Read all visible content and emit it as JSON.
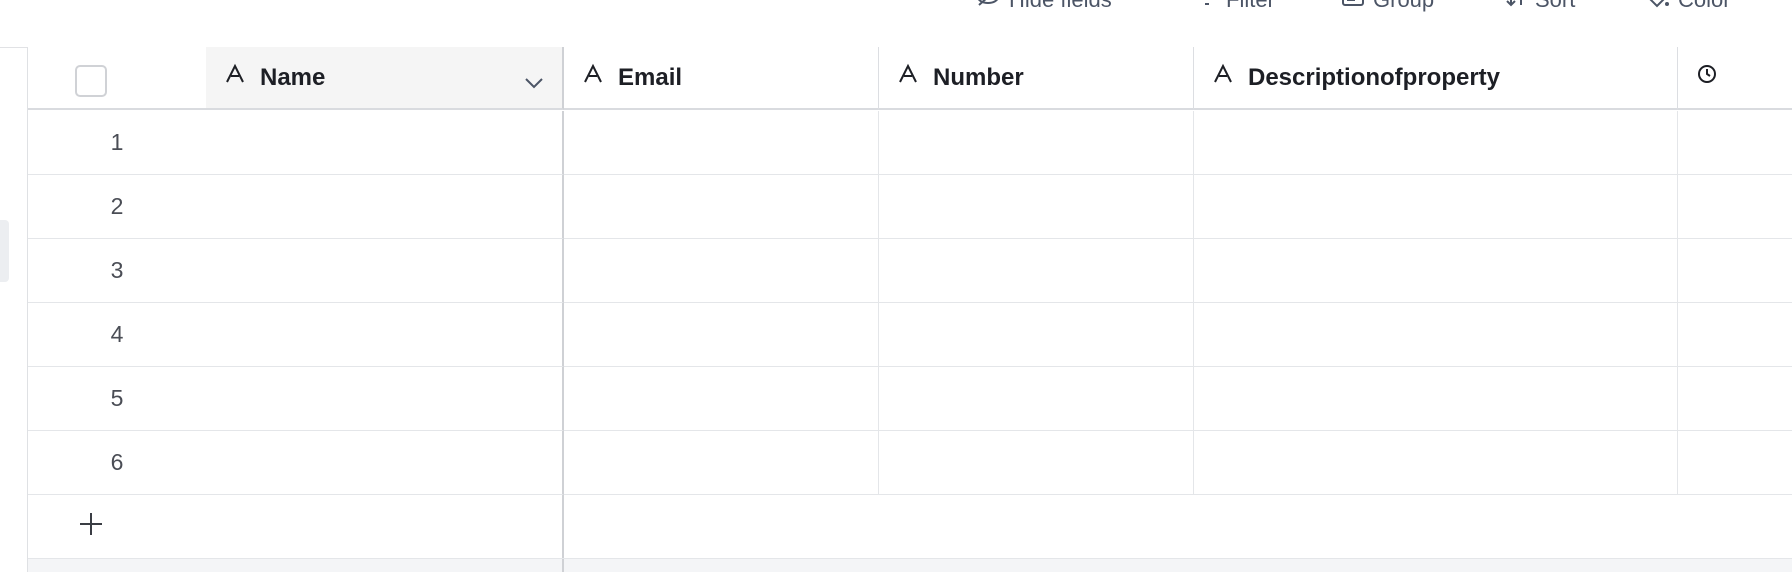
{
  "toolbar": {
    "hide_fields": "Hide fields",
    "filter": "Filter",
    "group": "Group",
    "sort": "Sort",
    "color": "Color"
  },
  "table": {
    "columns": [
      {
        "name": "Name",
        "type_icon": "text-field-icon"
      },
      {
        "name": "Email",
        "type_icon": "text-field-icon"
      },
      {
        "name": "Number",
        "type_icon": "text-field-icon"
      },
      {
        "name": "Descriptionofproperty",
        "type_icon": "text-field-icon"
      }
    ],
    "rows": [
      "1",
      "2",
      "3",
      "4",
      "5",
      "6"
    ]
  },
  "colors": {
    "header_selected_bg": "#f5f5f5",
    "grid_line": "#e4e6e9",
    "avatar": "#3c3f46"
  }
}
